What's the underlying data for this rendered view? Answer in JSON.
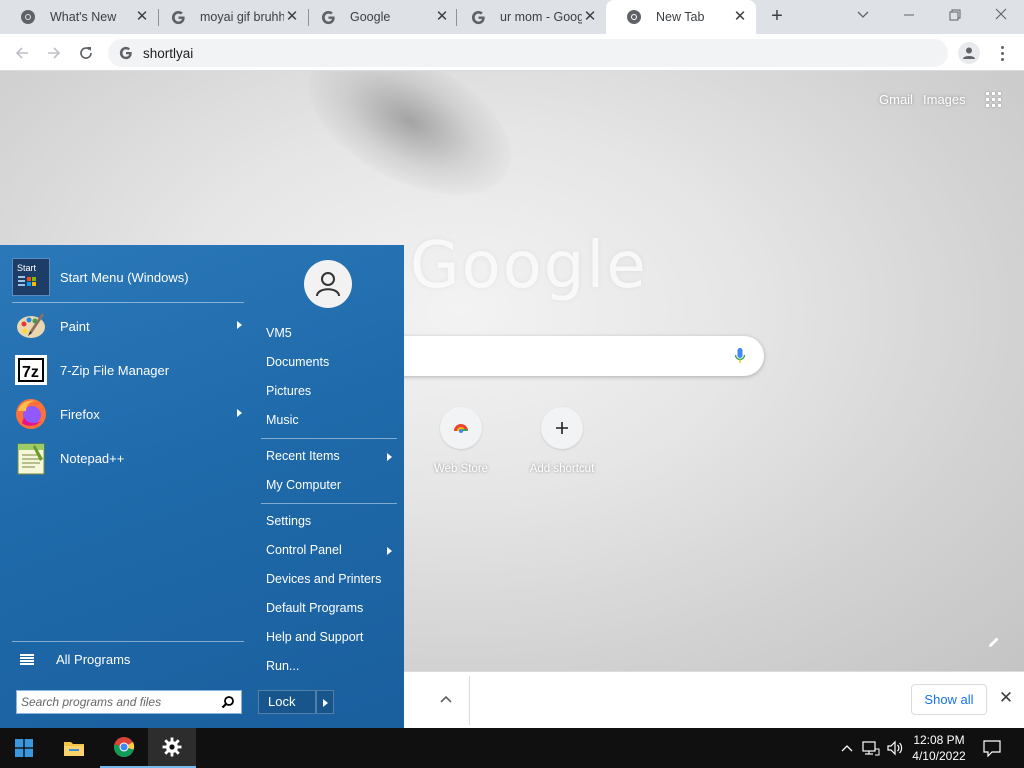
{
  "browser": {
    "tabs": [
      {
        "title": "What's New",
        "favicon": "chrome-icon"
      },
      {
        "title": "moyai gif bruhh",
        "favicon": "google-g-icon"
      },
      {
        "title": "Google",
        "favicon": "google-g-icon"
      },
      {
        "title": "ur mom - Goog",
        "favicon": "google-g-icon"
      },
      {
        "title": "New Tab",
        "favicon": "chrome-icon",
        "active": true
      }
    ],
    "new_tab_symbol": "+",
    "omnibox": {
      "value": "shortlyai"
    },
    "window_controls": {
      "dropdown": "⌄",
      "minimize": "—",
      "restore": "❐",
      "close": "✕"
    }
  },
  "ntp": {
    "gmail_label": "Gmail",
    "images_label": "Images",
    "logo_text": "Google",
    "shortcuts": [
      {
        "label": "Web Store",
        "icon": "web-store-icon"
      },
      {
        "label": "Add shortcut",
        "icon": "plus-icon",
        "symbol": "+"
      }
    ]
  },
  "download_shelf": {
    "show_all_label": "Show all",
    "close_symbol": "✕"
  },
  "start_menu": {
    "header_item": {
      "label": "Start Menu (Windows)",
      "icon_text": "Start"
    },
    "pinned": [
      {
        "label": "Paint",
        "icon": "paint-icon",
        "has_submenu": true
      },
      {
        "label": "7-Zip File Manager",
        "icon": "7zip-icon",
        "icon_text": "7z",
        "has_submenu": false
      },
      {
        "label": "Firefox",
        "icon": "firefox-icon",
        "has_submenu": true
      },
      {
        "label": "Notepad++",
        "icon": "notepadpp-icon",
        "has_submenu": false
      }
    ],
    "all_programs_label": "All Programs",
    "search_placeholder": "Search programs and files",
    "right_links": [
      {
        "label": "VM5",
        "has_submenu": false
      },
      {
        "label": "Documents",
        "has_submenu": false
      },
      {
        "label": "Pictures",
        "has_submenu": false
      },
      {
        "label": "Music",
        "has_submenu": false
      },
      {
        "label": "Recent Items",
        "has_submenu": true
      },
      {
        "label": "My Computer",
        "has_submenu": false
      },
      {
        "label": "Settings",
        "has_submenu": false
      },
      {
        "label": "Control Panel",
        "has_submenu": true
      },
      {
        "label": "Devices and Printers",
        "has_submenu": false
      },
      {
        "label": "Default Programs",
        "has_submenu": false
      },
      {
        "label": "Help and Support",
        "has_submenu": false
      },
      {
        "label": "Run...",
        "has_submenu": false
      }
    ],
    "lock_label": "Lock"
  },
  "taskbar": {
    "apps": [
      {
        "name": "start-button",
        "icon": "windows-logo-icon"
      },
      {
        "name": "file-explorer",
        "icon": "folder-icon"
      },
      {
        "name": "chrome",
        "icon": "chrome-icon"
      },
      {
        "name": "settings",
        "icon": "gear-icon"
      }
    ],
    "clock": {
      "time": "12:08 PM",
      "date": "4/10/2022"
    }
  },
  "colors": {
    "start_menu_blue": "#1f6aaa",
    "link_blue": "#1a73e8",
    "taskbar": "#101010",
    "tabstrip": "#dee1e6"
  }
}
